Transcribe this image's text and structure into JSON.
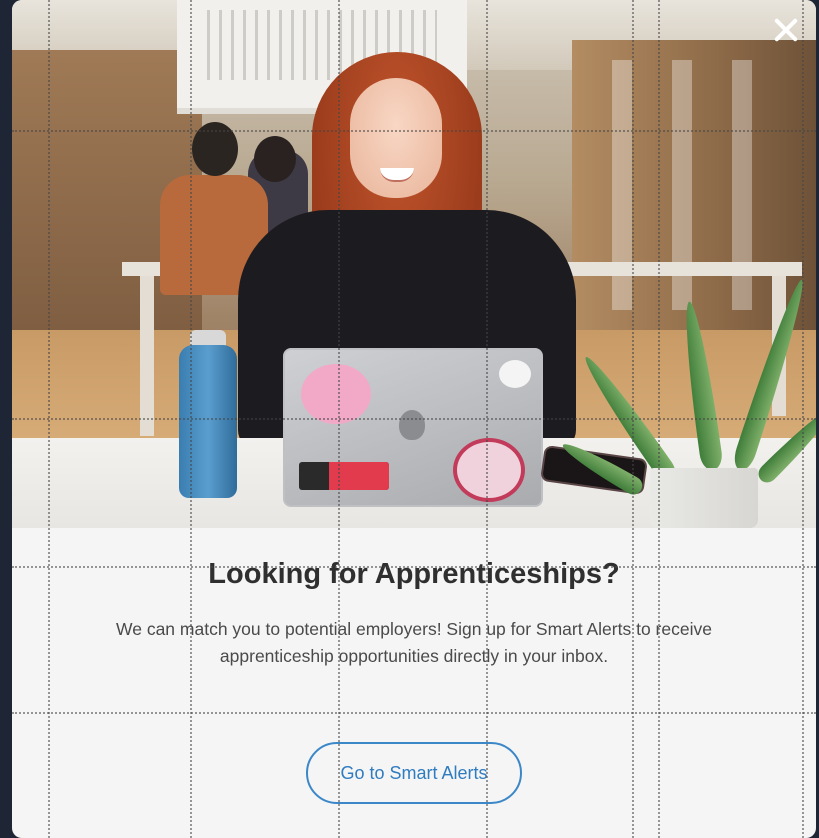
{
  "modal": {
    "close_icon": "close-icon",
    "hero_image": {
      "icon": "photo-woman-at-laptop"
    },
    "title": "Looking for Apprenticeships?",
    "description": "We can match you to potential employers! Sign up for Smart Alerts to receive apprenticeship opportunities directly in your inbox.",
    "cta_label": "Go to Smart Alerts"
  },
  "colors": {
    "accent": "#3b87c8",
    "background": "#f5f5f5",
    "title_text": "#2f2f2f",
    "body_text": "#4a4a4a",
    "page_backdrop": "#1e2636"
  }
}
